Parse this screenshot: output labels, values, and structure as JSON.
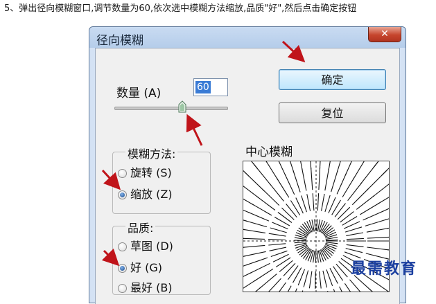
{
  "instruction": "5、弹出径向模糊窗口,调节数量为60,依次选中模糊方法缩放,品质\"好\",然后点击确定按钮",
  "dialog": {
    "title": "径向模糊",
    "close_label": "✕",
    "amount": {
      "label": "数量 (A)",
      "value": "60",
      "slider_fraction": 0.6
    },
    "blur_method": {
      "legend": "模糊方法:",
      "options": [
        {
          "label": "旋转 (S)",
          "checked": false
        },
        {
          "label": "缩放 (Z)",
          "checked": true
        }
      ]
    },
    "quality": {
      "legend": "品质:",
      "options": [
        {
          "label": "草图 (D)",
          "checked": false
        },
        {
          "label": "好 (G)",
          "checked": true
        },
        {
          "label": "最好 (B)",
          "checked": false
        }
      ]
    },
    "ok_label": "确定",
    "reset_label": "复位",
    "center_label": "中心模糊"
  },
  "watermark": "最需教育",
  "colors": {
    "annotation_arrow": "#c0141a",
    "default_button_border": "#3c7fb1"
  }
}
